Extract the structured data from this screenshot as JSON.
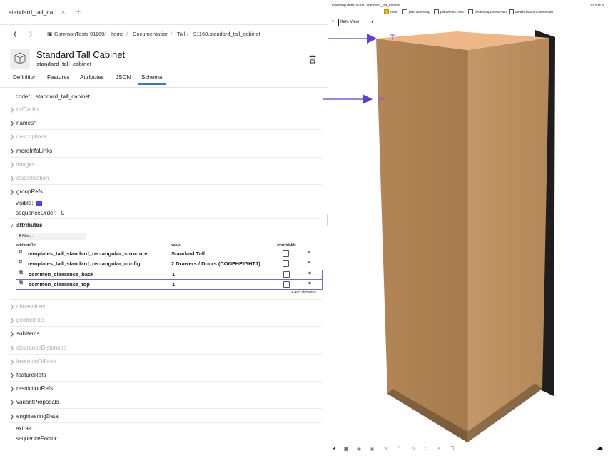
{
  "browser_tab": {
    "title": "standard_tall_ca..",
    "close": "×",
    "new_tab": "+"
  },
  "breadcrumb": [
    "CommonTests 91160",
    "Items",
    "Documentation",
    "Tall",
    "91160.standard_tall_cabinet"
  ],
  "breadcrumb_sep": "/",
  "header": {
    "title": "Standard Tall Cabinet",
    "subtitle": "standard_tall_cabinet"
  },
  "tabs": [
    "Definition",
    "Features",
    "Attributes",
    "JSON",
    "Schema"
  ],
  "active_tab": "Schema",
  "code": {
    "label": "code",
    "required": "*",
    "colon": ":",
    "value": "standard_tall_cabinet"
  },
  "schema_rows_top": [
    {
      "label": "refCodes",
      "muted": true
    },
    {
      "label": "names",
      "required": true,
      "muted": false
    },
    {
      "label": "descriptions",
      "muted": true
    },
    {
      "label": "moreInfoLinks",
      "muted": false
    },
    {
      "label": "images",
      "muted": true
    },
    {
      "label": "classification",
      "muted": true
    },
    {
      "label": "groupRefs",
      "muted": false
    }
  ],
  "visible_label": "visible:",
  "sequence_order": {
    "label": "sequenceOrder:",
    "value": "0"
  },
  "attributes": {
    "label": "attributes",
    "filter_placeholder": "Filter...",
    "columns": [
      "attributeRef",
      "value",
      "overridable"
    ],
    "rows": [
      {
        "ref": "templates_tall_standard_rectangular_structure",
        "value": "Standard Tall",
        "boxed": false
      },
      {
        "ref": "templates_tall_standard_rectangular_config",
        "value": "2 Drawers / Doors (CONFHEIGHT1)",
        "boxed": false
      },
      {
        "ref": "common_clearance_back",
        "value": "1",
        "boxed": true
      },
      {
        "ref": "common_clearance_top",
        "value": "1",
        "boxed": true
      }
    ],
    "remove": "×",
    "add_label": "+ Add attributes"
  },
  "schema_rows_bottom": [
    {
      "label": "dimensions",
      "muted": true
    },
    {
      "label": "geometries",
      "muted": true
    },
    {
      "label": "subItems",
      "muted": false
    },
    {
      "label": "clearanceDistances",
      "muted": true
    },
    {
      "label": "insertionOffsets",
      "muted": true
    },
    {
      "label": "featureRefs",
      "muted": false
    },
    {
      "label": "restrictionRefs",
      "muted": false
    },
    {
      "label": "variantProposals",
      "muted": false
    },
    {
      "label": "engineeringData",
      "muted": false
    }
  ],
  "extras_label": "extras:",
  "sequence_factor_label": "sequenceFactor:",
  "viewer": {
    "observing": "Observing Item: 91160.standard_tall_cabinet",
    "fps": "120.90KB",
    "checkboxes": [
      {
        "label": "main",
        "checked": true
      },
      {
        "label": "planViews.top",
        "checked": false
      },
      {
        "label": "planViews.front",
        "checked": false
      },
      {
        "label": "details.topLinearPath",
        "checked": false
      },
      {
        "label": "details.bottomLinearPath",
        "checked": false
      }
    ],
    "view_select": "Item View"
  },
  "colors": {
    "accent": "#5a3fe0",
    "boxed_border": "#8b5cd6",
    "wood": "#b98a5e",
    "top": "#efb788"
  }
}
